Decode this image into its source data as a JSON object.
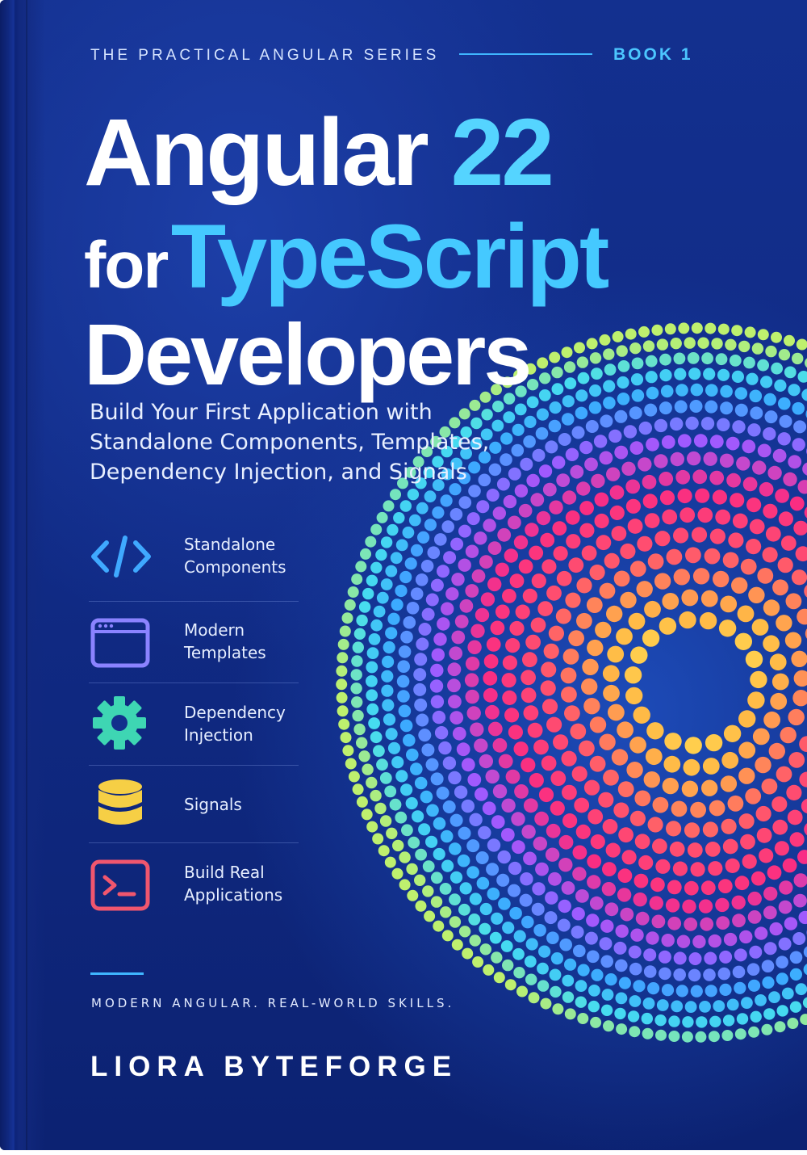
{
  "cover": {
    "series": "THE PRACTICAL ANGULAR SERIES",
    "book_number": "BOOK 1",
    "title": {
      "line1_word": "Angular",
      "line1_number": "22",
      "line2_prefix": "for",
      "line2_highlight": "TypeScript",
      "line3": "Developers"
    },
    "subtitle": [
      "Build Your First Application with",
      "Standalone Components, Templates,",
      "Dependency Injection, and Signals"
    ],
    "features": [
      {
        "icon": "code-brackets-icon",
        "color": "#3fa9ff",
        "lines": [
          "Standalone",
          "Components"
        ]
      },
      {
        "icon": "browser-window-icon",
        "color": "#8b83ff",
        "lines": [
          "Modern",
          "Templates"
        ]
      },
      {
        "icon": "gear-icon",
        "color": "#3ed6b3",
        "lines": [
          "Dependency",
          "Injection"
        ]
      },
      {
        "icon": "database-icon",
        "color": "#f6cf45",
        "lines": [
          "Signals"
        ]
      },
      {
        "icon": "terminal-icon",
        "color": "#f0566e",
        "lines": [
          "Build Real",
          "Applications"
        ]
      }
    ],
    "tagline": "MODERN ANGULAR. REAL-WORLD SKILLS.",
    "author": "LIORA BYTEFORGE",
    "colors": {
      "background": "#13308f",
      "accent": "#45c9ff",
      "dot_palette": [
        "#ff2f7a",
        "#ff6f5a",
        "#ffb84a",
        "#f6e65a",
        "#b8f06a",
        "#45d0ff",
        "#7a7cff",
        "#d24bff"
      ]
    }
  }
}
